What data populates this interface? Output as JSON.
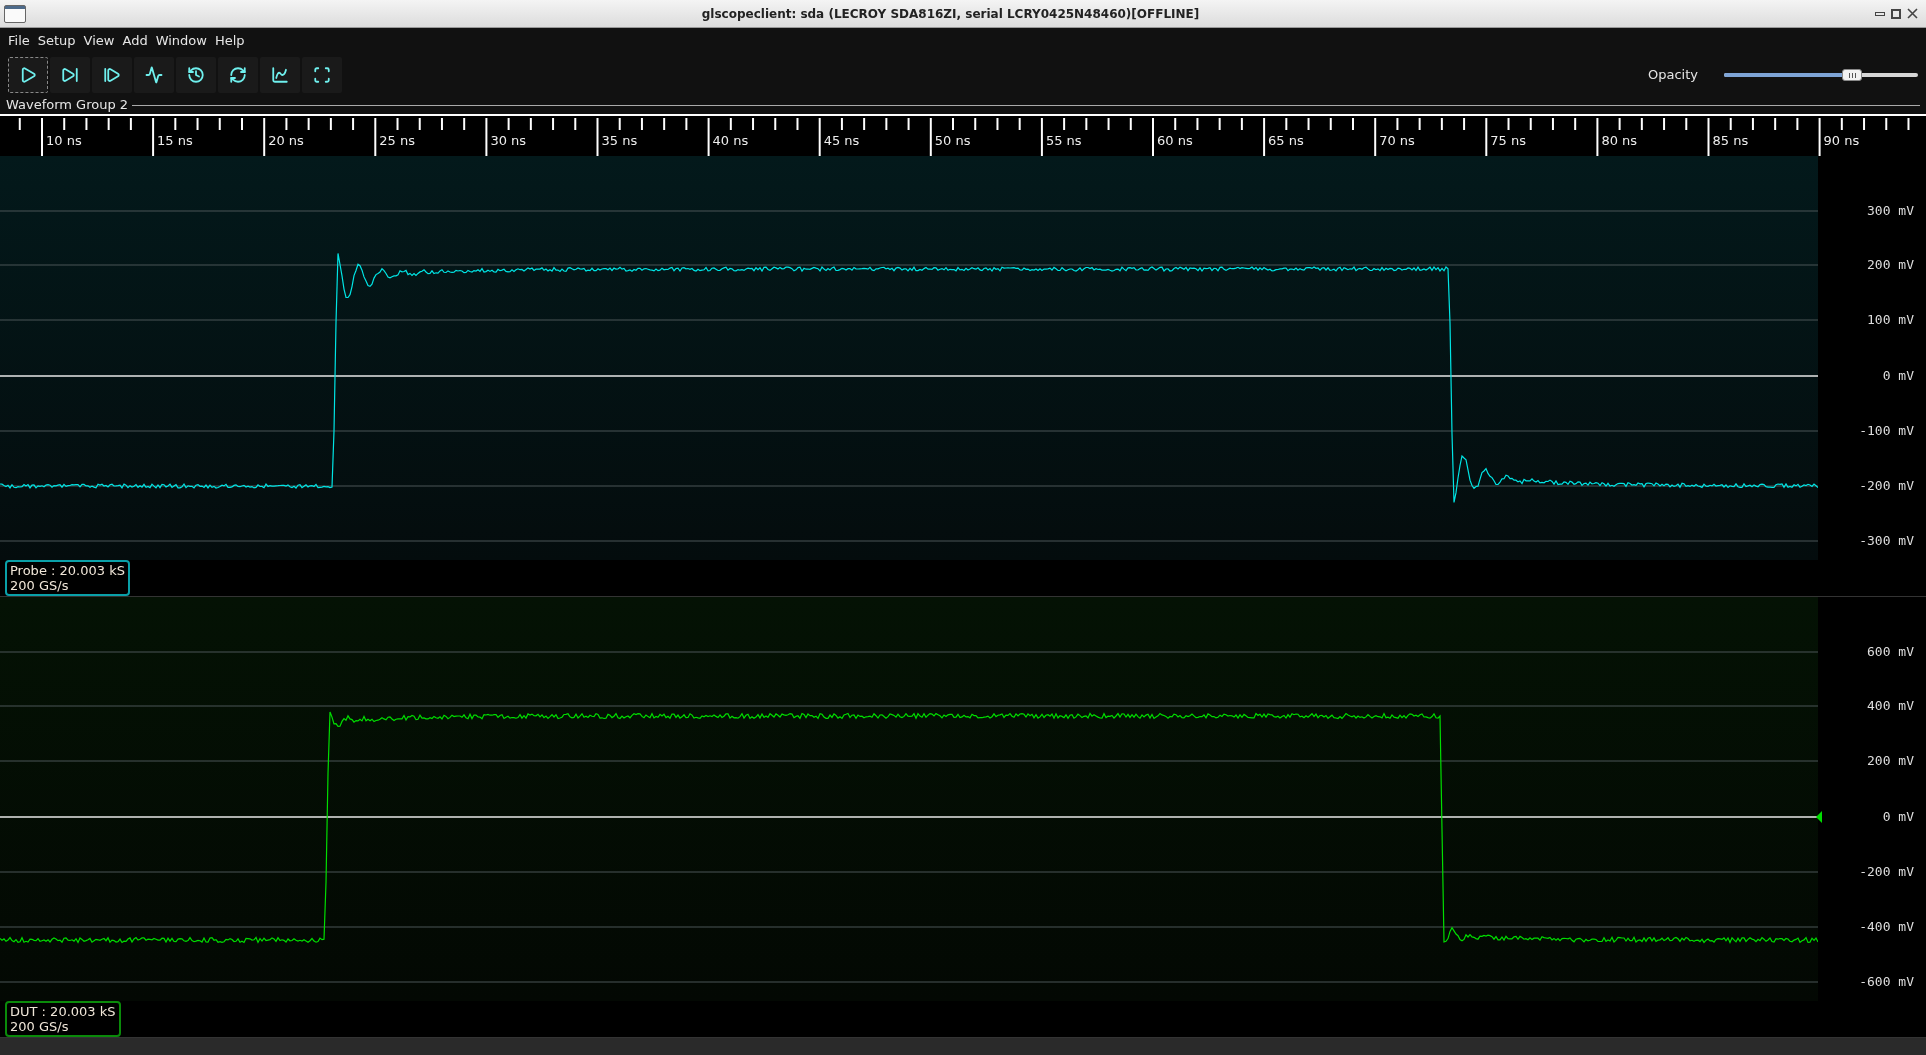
{
  "window": {
    "title": "glscopeclient: sda (LECROY SDA816ZI, serial LCRY0425N48460)[OFFLINE]"
  },
  "menu": [
    "File",
    "Setup",
    "View",
    "Add",
    "Window",
    "Help"
  ],
  "toolbar": {
    "buttons": [
      {
        "kind": "start",
        "focused": true
      },
      {
        "kind": "single",
        "focused": false
      },
      {
        "kind": "force",
        "focused": false
      },
      {
        "kind": "waveform",
        "focused": false
      },
      {
        "kind": "history",
        "focused": false
      },
      {
        "kind": "refresh",
        "focused": false
      },
      {
        "kind": "fit",
        "focused": false
      },
      {
        "kind": "fullscreen",
        "focused": false
      }
    ]
  },
  "opacity": {
    "label": "Opacity",
    "level": 0.66
  },
  "waveform_group": {
    "title": "Waveform Group 2"
  },
  "ruler": {
    "labels": [
      "10 ns",
      "15 ns",
      "20 ns",
      "25 ns",
      "30 ns",
      "35 ns",
      "40 ns",
      "45 ns",
      "50 ns",
      "55 ns",
      "60 ns",
      "65 ns",
      "70 ns",
      "75 ns",
      "80 ns",
      "85 ns",
      "90 ns"
    ]
  },
  "channels": [
    {
      "name": "Probe : 20.003 kS",
      "rate": "200 GS/s",
      "color": "#00e5e5",
      "offset_marker": false,
      "axis_labels": [
        "300 mV",
        "200 mV",
        "100 mV",
        "0 mV",
        "-100 mV",
        "-200 mV",
        "-300 mV"
      ]
    },
    {
      "name": "DUT : 20.003 kS",
      "rate": "200 GS/s",
      "color": "#00dd00",
      "offset_marker": true,
      "axis_labels": [
        "600 mV",
        "400 mV",
        "200 mV",
        "0 mV",
        "-200 mV",
        "-400 mV",
        "-600 mV"
      ]
    }
  ]
}
